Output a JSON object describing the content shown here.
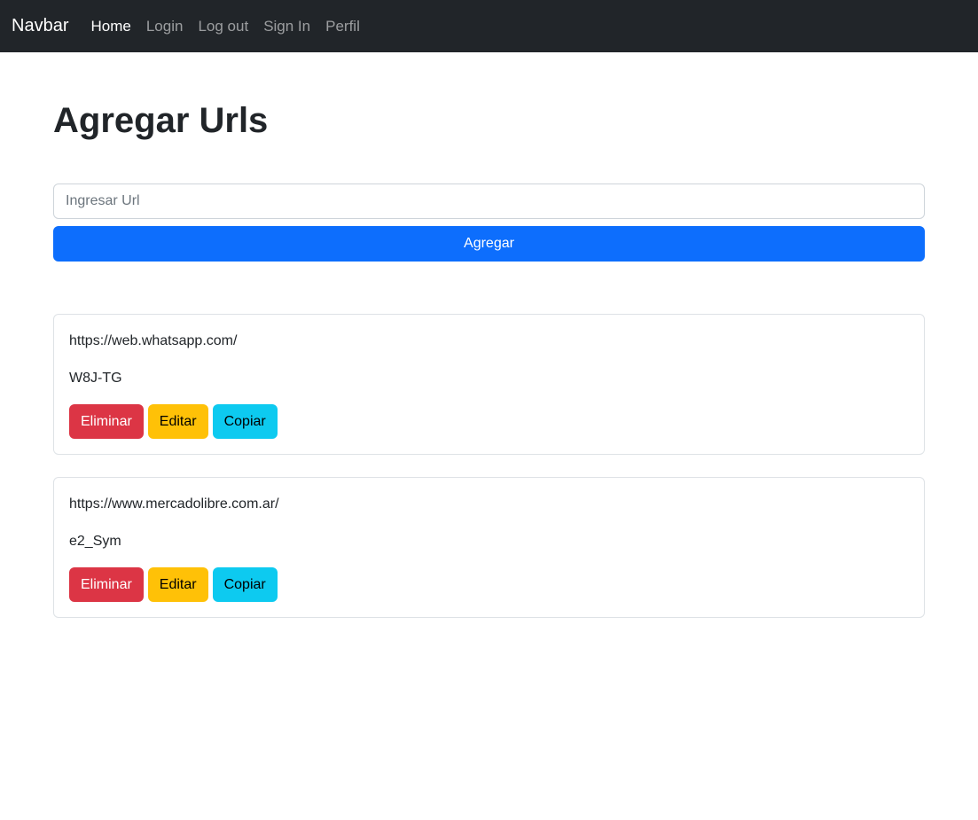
{
  "navbar": {
    "brand": "Navbar",
    "links": [
      {
        "label": "Home",
        "active": true
      },
      {
        "label": "Login",
        "active": false
      },
      {
        "label": "Log out",
        "active": false
      },
      {
        "label": "Sign In",
        "active": false
      },
      {
        "label": "Perfil",
        "active": false
      }
    ]
  },
  "main": {
    "title": "Agregar Urls",
    "input": {
      "placeholder": "Ingresar Url",
      "value": ""
    },
    "add_button_label": "Agregar"
  },
  "urls": [
    {
      "original": "https://web.whatsapp.com/",
      "short": "W8J-TG",
      "delete_label": "Eliminar",
      "edit_label": "Editar",
      "copy_label": "Copiar"
    },
    {
      "original": "https://www.mercadolibre.com.ar/",
      "short": "e2_Sym",
      "delete_label": "Eliminar",
      "edit_label": "Editar",
      "copy_label": "Copiar"
    }
  ],
  "colors": {
    "navbar_bg": "#212529",
    "primary": "#0d6efd",
    "danger": "#dc3545",
    "warning": "#ffc107",
    "info": "#0dcaf0"
  }
}
